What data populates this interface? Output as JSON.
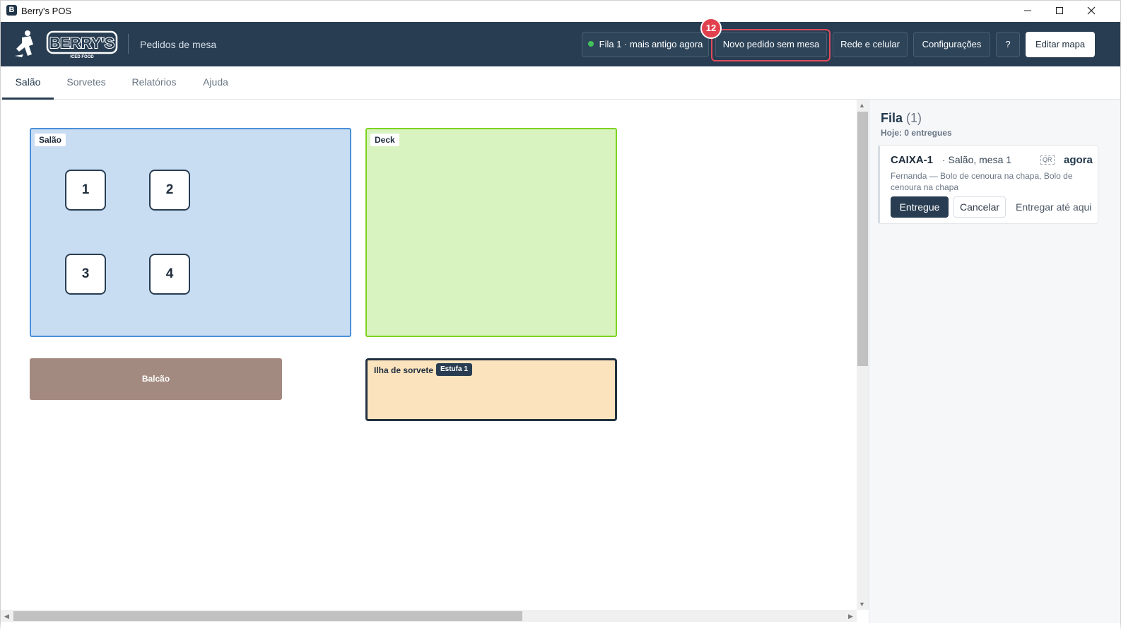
{
  "window": {
    "title": "Berry's POS",
    "icon_letter": "B"
  },
  "header": {
    "logo_text": "BERRY'S",
    "logo_sub": "ICED FOOD",
    "page_title": "Pedidos de mesa",
    "queue_status": "Fila 1 · mais antigo agora",
    "new_order_label": "Novo pedido sem mesa",
    "network_label": "Rede e celular",
    "settings_label": "Configurações",
    "help_label": "?",
    "edit_map_label": "Editar mapa",
    "notification_count": "12",
    "status_color": "#42c25a",
    "highlight_color": "#e04b5a"
  },
  "tabs": [
    {
      "label": "Salão",
      "active": true
    },
    {
      "label": "Sorvetes",
      "active": false
    },
    {
      "label": "Relatórios",
      "active": false
    },
    {
      "label": "Ajuda",
      "active": false
    }
  ],
  "map": {
    "zones": [
      {
        "label": "Salão",
        "color": "#c8dcf2",
        "border": "#4a90d9"
      },
      {
        "label": "Deck",
        "color": "#d8f3c0",
        "border": "#7ed321"
      },
      {
        "label": "Balcão",
        "color": "#a38a80"
      },
      {
        "label": "Ilha de sorvete",
        "color": "#fbe3bd",
        "border": "#22313f",
        "tag": "Estufa 1"
      }
    ],
    "tables": [
      "1",
      "2",
      "3",
      "4"
    ]
  },
  "queue": {
    "title": "Fila",
    "count": "(1)",
    "subtitle": "Hoje: 0 entregues",
    "orders": [
      {
        "id": "CAIXA-1",
        "location": "· Salão, mesa 1",
        "qr": "QR",
        "time": "agora",
        "description": "Fernanda — Bolo de cenoura na chapa, Bolo de cenoura na chapa",
        "deliver_label": "Entregue",
        "cancel_label": "Cancelar",
        "deliver_until_label": "Entregar até aqui"
      }
    ]
  }
}
